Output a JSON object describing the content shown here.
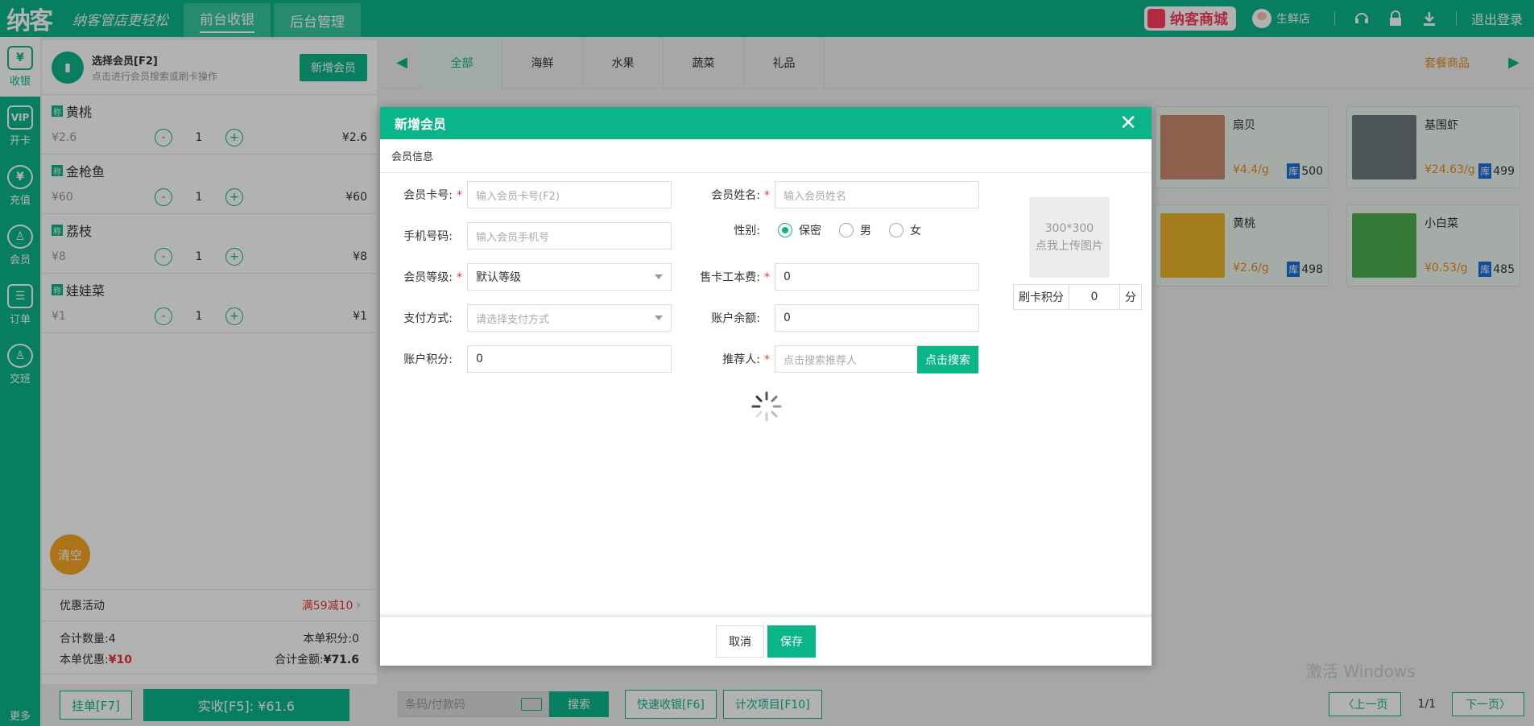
{
  "header": {
    "logo": "纳客",
    "slogan": "纳客管店更轻松",
    "tabs": [
      {
        "label": "前台收银",
        "active": true
      },
      {
        "label": "后台管理",
        "active": false
      }
    ],
    "mall_label": "纳客商城",
    "store_name": "生鲜店",
    "logout": "退出登录"
  },
  "rail": {
    "items": [
      {
        "label": "收银",
        "icon": "¥",
        "active": true
      },
      {
        "label": "开卡",
        "icon": "VIP",
        "active": false
      },
      {
        "label": "充值",
        "icon": "¥",
        "active": false
      },
      {
        "label": "会员",
        "icon": "♙",
        "active": false
      },
      {
        "label": "订单",
        "icon": "☰",
        "active": false
      },
      {
        "label": "交班",
        "icon": "♙",
        "active": false
      }
    ],
    "more": "更多"
  },
  "cart": {
    "member_title": "选择会员[F2]",
    "member_hint": "点击进行会员搜索或刷卡操作",
    "add_member": "新增会员",
    "weigh_tag": "称",
    "items": [
      {
        "name": "黄桃",
        "price": "¥2.6",
        "qty": "1",
        "subtotal": "¥2.6"
      },
      {
        "name": "金枪鱼",
        "price": "¥60",
        "qty": "1",
        "subtotal": "¥60"
      },
      {
        "name": "荔枝",
        "price": "¥8",
        "qty": "1",
        "subtotal": "¥8"
      },
      {
        "name": "娃娃菜",
        "price": "¥1",
        "qty": "1",
        "subtotal": "¥1"
      }
    ],
    "clear": "清空",
    "promo_label": "优惠活动",
    "promo_value": "满59减10",
    "total_qty_label": "合计数量:",
    "total_qty": "4",
    "points_label": "本单积分:",
    "points": "0",
    "discount_label": "本单优惠:",
    "discount": "¥10",
    "amount_label": "合计金额:",
    "amount": "¥71.6",
    "hang_btn": "挂单[F7]",
    "pay_btn": "实收[F5]:  ¥61.6"
  },
  "categories": {
    "items": [
      "全部",
      "海鲜",
      "水果",
      "蔬菜",
      "礼品"
    ],
    "active": "全部",
    "package": "套餐商品"
  },
  "products": [
    {
      "name": "扇贝",
      "price": "¥4.4/g",
      "stock_tag": "库",
      "stock": "500",
      "color": "#c98a6a"
    },
    {
      "name": "基围虾",
      "price": "¥24.63/g",
      "stock_tag": "库",
      "stock": "499",
      "color": "#6f7a80"
    },
    {
      "name": "黄桃",
      "price": "¥2.6/g",
      "stock_tag": "库",
      "stock": "498",
      "color": "#e8b22a"
    },
    {
      "name": "小白菜",
      "price": "¥0.53/g",
      "stock_tag": "库",
      "stock": "485",
      "color": "#4caf50"
    }
  ],
  "bottom": {
    "barcode_placeholder": "条码/付款码",
    "search": "搜索",
    "quick_pay": "快速收银[F6]",
    "count_item": "计次项目[F10]",
    "prev": "上一页",
    "page": "1/1",
    "next": "下一页",
    "watermark": "激活 Windows"
  },
  "modal": {
    "title": "新增会员",
    "section": "会员信息",
    "fields": {
      "card_label": "会员卡号:",
      "card_ph": "输入会员卡号(F2)",
      "name_label": "会员姓名:",
      "name_ph": "输入会员姓名",
      "phone_label": "手机号码:",
      "phone_ph": "输入会员手机号",
      "gender_label": "性别:",
      "gender_options": [
        "保密",
        "男",
        "女"
      ],
      "gender_selected": "保密",
      "level_label": "会员等级:",
      "level_value": "默认等级",
      "fee_label": "售卡工本费:",
      "fee_value": "0",
      "payment_label": "支付方式:",
      "payment_ph": "请选择支付方式",
      "balance_label": "账户余额:",
      "balance_value": "0",
      "points_label": "账户积分:",
      "points_value": "0",
      "referrer_label": "推荐人:",
      "referrer_ph": "点击搜索推荐人",
      "referrer_btn": "点击搜索"
    },
    "upload_size": "300*300",
    "upload_hint": "点我上传图片",
    "swipe_points_label": "刷卡积分",
    "swipe_points_value": "0",
    "swipe_points_unit": "分",
    "cancel": "取消",
    "save": "保存"
  },
  "colors": {
    "primary": "#0bb58a",
    "danger": "#e53935",
    "orange": "#e88a1c"
  }
}
